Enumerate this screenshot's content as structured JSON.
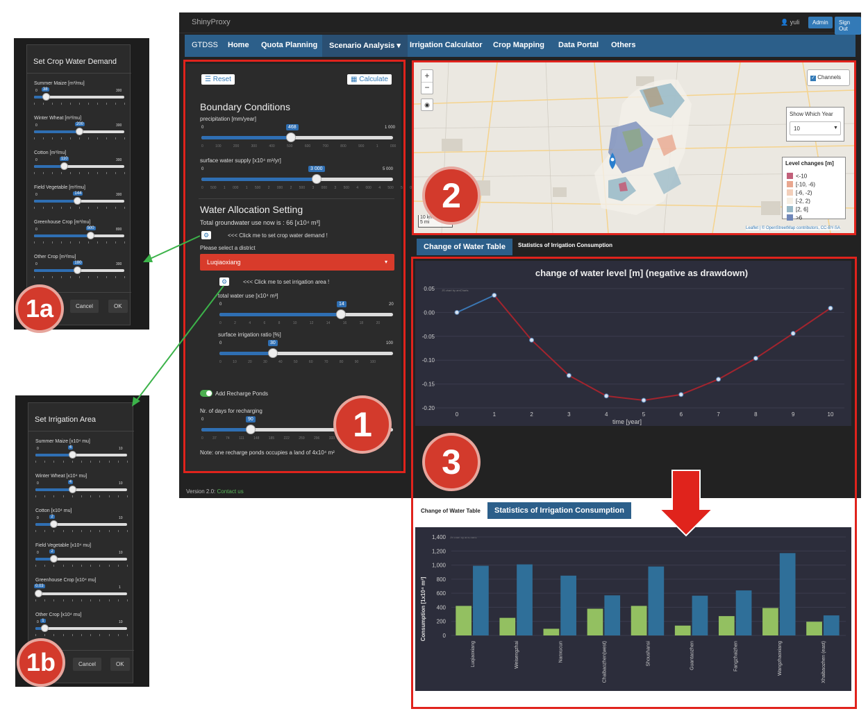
{
  "app": {
    "brand": "ShinyProxy",
    "user": "yuli",
    "admin_label": "Admin",
    "signout_label": "Sign Out",
    "nav": [
      "GTDSS",
      "Home",
      "Quota Planning",
      "Scenario Analysis ▾",
      "Irrigation Calculator",
      "Crop Mapping",
      "Data Portal",
      "Others"
    ],
    "version_prefix": "Version 2.0:",
    "contact_label": "Contact us"
  },
  "sidebar": {
    "reset_label": "Reset",
    "calculate_label": "Calculate",
    "boundary_title": "Boundary Conditions",
    "precip_label": "precipitation [mm/year]",
    "precip_value": "468",
    "precip_min": "0",
    "precip_max": "1 000",
    "precip_ticks": "0 100 200 300 400 500 600 700 800 900 1 000",
    "surface_label": "surface water supply [x10⁴ m³/yr]",
    "surface_value": "3 000",
    "surface_min": "0",
    "surface_max": "5 000",
    "surface_ticks": "0 500 1 000 1 500 2 000 2 500 3 000 3 500 4 000 4 500 5 000",
    "allocation_title": "Water Allocation Setting",
    "total_gw": "Total groundwater use now is : 66 [x10⁴ m³]",
    "crop_demand_hint": "<<< Click me to set crop water demand !",
    "district_prompt": "Please select a district",
    "district_value": "Luqiaoxiang",
    "irr_area_hint": "<<< Click me to set irrigation area !",
    "total_water_label": "total water use [x10⁴ m³]",
    "total_water_value": "14",
    "total_water_min": "0",
    "total_water_max": "20",
    "total_water_ticks": "0 2 4 6 8 10 12 14 16 18 20",
    "surface_ratio_label": "surface irrigation ratio [%]",
    "surface_ratio_value": "30",
    "surface_ratio_min": "0",
    "surface_ratio_max": "100",
    "surface_ratio_ticks": "0 10 20 30 40 50 60 70 80 90 100",
    "recharge_toggle": "Add Recharge Ponds",
    "recharge_days_label": "Nr. of days for recharging",
    "recharge_days_value": "90",
    "recharge_days_min": "0",
    "recharge_days_ticks": "0 37 74 111 148 185 222 259 296 333 365",
    "recharge_note": "Note: one recharge ponds occupies a land of 4x10⁴ m²"
  },
  "map": {
    "zoom_in": "+",
    "zoom_out": "−",
    "channels_label": "Channels",
    "year_label": "Show Which Year",
    "year_value": "10",
    "legend_title": "Level changes [m]",
    "legend_items": [
      {
        "label": "<-10",
        "color": "#c2607a"
      },
      {
        "label": "[-10, -6)",
        "color": "#e9a78f"
      },
      {
        "label": "[-6, -2)",
        "color": "#f3cfba"
      },
      {
        "label": "[-2, 2)",
        "color": "#f6efe4"
      },
      {
        "label": "[2, 6]",
        "color": "#97b8c7"
      },
      {
        "label": ">6",
        "color": "#6f86b8"
      }
    ],
    "scale_km": "10 km",
    "scale_mi": "5 mi",
    "attribution": "Leaflet | © OpenStreetMap contributors, CC-BY-SA"
  },
  "tabs": {
    "water_table": "Change of Water Table",
    "irrigation": "Statistics of Irrigation Consumption"
  },
  "badges": {
    "one": "1",
    "two": "2",
    "three": "3",
    "one_a": "1a",
    "one_b": "1b"
  },
  "line_chart": {
    "title": "change of water level [m] (negative as drawdown)",
    "credit": "JS chart by amCharts",
    "xlabel": "time [year]",
    "x": [
      0,
      1,
      2,
      3,
      4,
      5,
      6,
      7,
      8,
      9,
      10
    ],
    "y": [
      0.0,
      0.036,
      -0.058,
      -0.132,
      -0.175,
      -0.184,
      -0.172,
      -0.14,
      -0.096,
      -0.044,
      0.009
    ],
    "ylim": [
      -0.2,
      0.05
    ],
    "yticks": [
      "0.05",
      "0.00",
      "-0.05",
      "-0.10",
      "-0.15",
      "-0.20"
    ],
    "colors": {
      "rise": "#3b78b5",
      "fall": "#a3242e",
      "point": "#d8e3f0"
    }
  },
  "chart_data": {
    "type": "bar",
    "ylabel": "Consumption [1x10⁴ m³]",
    "credit": "JS chart by amCharts",
    "categories": [
      "Luqiaoxiang",
      "Weisengzhai",
      "Nanxucun",
      "Chaibaozhen(west)",
      "Shoushansi",
      "Guantaozhen",
      "Fangzhaizhen",
      "Wangzhaoxiang",
      "Xhaibaozhen (east)"
    ],
    "series": [
      {
        "values": [
          420,
          250,
          95,
          380,
          420,
          140,
          275,
          390,
          195
        ],
        "color": "#93c061"
      },
      {
        "values": [
          990,
          1010,
          850,
          570,
          980,
          565,
          640,
          1170,
          285
        ],
        "color": "#2f6f99"
      }
    ],
    "ylim": [
      0,
      1400
    ],
    "yticks": [
      "0",
      "200",
      "400",
      "600",
      "800",
      "1,000",
      "1,200",
      "1,400"
    ]
  },
  "popup_1a": {
    "title": "Set Crop Water Demand",
    "cancel": "Cancel",
    "ok": "OK",
    "sliders": [
      {
        "label": "Summer Maize [m³/mu]",
        "value": "38",
        "min": "0",
        "max": "300",
        "fraction": 0.13
      },
      {
        "label": "Winter Wheat [m³/mu]",
        "value": "200",
        "min": "0",
        "max": "300",
        "fraction": 0.5
      },
      {
        "label": "Cotton [m³/mu]",
        "value": "110",
        "min": "0",
        "max": "300",
        "fraction": 0.33
      },
      {
        "label": "Field Vegetable [m³/mu]",
        "value": "144",
        "min": "0",
        "max": "300",
        "fraction": 0.48
      },
      {
        "label": "Greenhouse Crop [m³/mu]",
        "value": "500",
        "min": "0",
        "max": "800",
        "fraction": 0.62
      },
      {
        "label": "Other Crop [m³/mu]",
        "value": "180",
        "min": "0",
        "max": "300",
        "fraction": 0.48
      }
    ]
  },
  "popup_1b": {
    "title": "Set Irrigation Area",
    "cancel": "Cancel",
    "ok": "OK",
    "sliders": [
      {
        "label": "Summer Maize [x10⁴ mu]",
        "value": "4",
        "min": "0",
        "max": "10",
        "fraction": 0.4
      },
      {
        "label": "Winter Wheat [x10⁴ mu]",
        "value": "4",
        "min": "0",
        "max": "10",
        "fraction": 0.4
      },
      {
        "label": "Cotton [x10⁴ mu]",
        "value": "2",
        "min": "0",
        "max": "10",
        "fraction": 0.2
      },
      {
        "label": "Field Vegetable [x10⁴ mu]",
        "value": "2",
        "min": "0",
        "max": "10",
        "fraction": 0.2
      },
      {
        "label": "Greenhouse Crop [x10⁴ mu]",
        "value": "0.03",
        "min": "0",
        "max": "1",
        "fraction": 0.03
      },
      {
        "label": "Other Crop [x10⁴ mu]",
        "value": "1",
        "min": "0",
        "max": "10",
        "fraction": 0.1
      }
    ]
  }
}
